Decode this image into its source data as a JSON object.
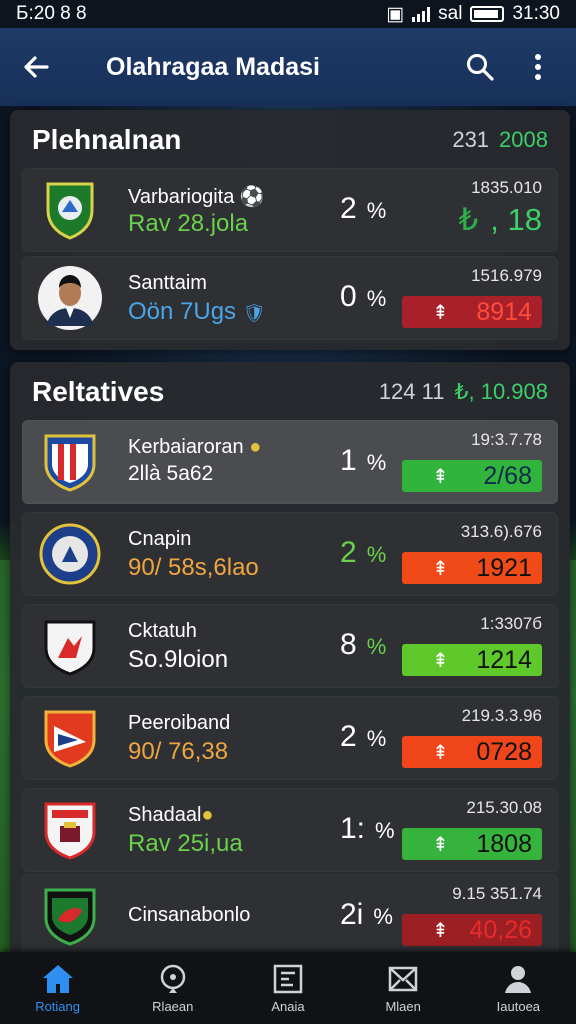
{
  "status_bar": {
    "time_left": "Б:20 8 8",
    "network": "sal",
    "time_right": "31:30"
  },
  "app_bar": {
    "title": "Olahragaa Madasi"
  },
  "section1": {
    "title": "Plehnalnan",
    "stat_a": "231",
    "stat_b": "2008",
    "rows": [
      {
        "name": "Varbariogita",
        "sub": "Rav 28.jola",
        "pct_value": "2",
        "pct_sign": "%",
        "small": "1835.010",
        "value": ", 18",
        "value_prefix": "₺",
        "type": "plain"
      },
      {
        "name": "Santtaim",
        "sub": "Oön 7Ugs",
        "pct_value": "0",
        "pct_sign": "%",
        "small": "1516.979",
        "value": "8914",
        "type": "bar",
        "bar_color": "#a7202a",
        "value_color": "#ff4b3a"
      }
    ]
  },
  "section2": {
    "title": "Reltatives",
    "stat_a": "124 11",
    "stat_b": "10.908",
    "stat_b_prefix": "₺,",
    "rows": [
      {
        "name": "Kerbaiaroran",
        "sub": "2llà 5a62",
        "pct_value": "1",
        "pct_sign": "%",
        "small": "19:3.7.78",
        "value": "2/68",
        "type": "bar",
        "bar_color": "#31b43c",
        "value_color": "#0e2a4a"
      },
      {
        "name": "Cnapin",
        "sub": "90/ 58s,6lao",
        "pct_value": "2",
        "pct_sign": "%",
        "small": "313.6).676",
        "value": "1921",
        "type": "bar",
        "bar_color": "#f04a18",
        "value_color": "#111"
      },
      {
        "name": "Cktatuh",
        "sub": "So.9loion",
        "pct_value": "8",
        "pct_sign": "%",
        "small": "1:3307б",
        "value": "1214",
        "type": "bar",
        "bar_color": "#5fc82b",
        "value_color": "#111"
      },
      {
        "name": "Peeroiband",
        "sub": "90/ 76,38",
        "pct_value": "2",
        "pct_sign": "%",
        "small": "219.3.3.96",
        "value": "0728",
        "type": "bar",
        "bar_color": "#f0451a",
        "value_color": "#111"
      },
      {
        "name": "Shadaal",
        "sub": "Rav 25i,ua",
        "pct_value": "1:",
        "pct_sign": "%",
        "small": "215.30.08",
        "value": "1808",
        "type": "bar",
        "bar_color": "#35b33d",
        "value_color": "#111"
      },
      {
        "name": "Cinsanabonlo",
        "sub": "",
        "pct_value": "2i",
        "pct_sign": "%",
        "small": "9.15 351.74",
        "value": "40,26",
        "type": "bar",
        "bar_color": "#9c1f24",
        "value_color": "#e82a2a"
      }
    ]
  },
  "nav": [
    {
      "label": "Rotiang",
      "icon": "home-icon",
      "active": true
    },
    {
      "label": "Rlaean",
      "icon": "location-icon",
      "active": false
    },
    {
      "label": "Anaia",
      "icon": "board-icon",
      "active": false
    },
    {
      "label": "Mlaen",
      "icon": "envelope-icon",
      "active": false
    },
    {
      "label": "Iautoea",
      "icon": "profile-icon",
      "active": false
    }
  ],
  "colors": {
    "accent": "#2f8ff0",
    "green": "#3ccf6a",
    "appbar": "#1e3a66"
  }
}
